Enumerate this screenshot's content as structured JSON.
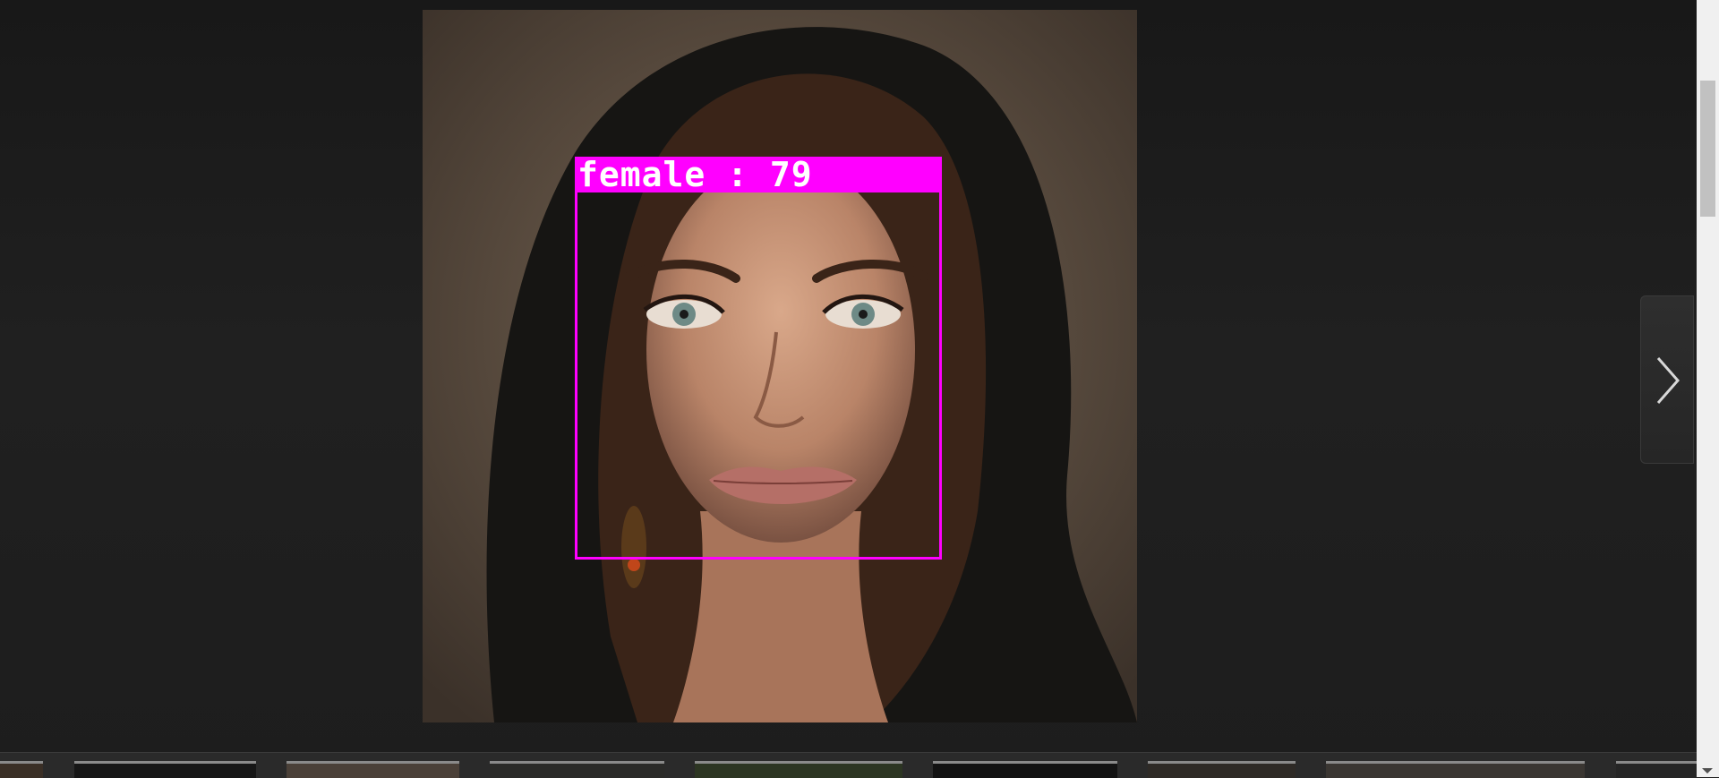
{
  "viewer": {
    "detection": {
      "label": "female : 79",
      "box_color": "#ff00ff",
      "label_text_color": "#ffffff"
    },
    "next_button": {
      "icon": "chevron-right-icon"
    }
  },
  "thumbnails": [
    {
      "name": "thumbnail-1",
      "color": "#3a2f26"
    },
    {
      "name": "thumbnail-2",
      "color": "#161616"
    },
    {
      "name": "thumbnail-3",
      "color": "#4a4038"
    },
    {
      "name": "thumbnail-4",
      "color": "#2a2a28"
    },
    {
      "name": "thumbnail-5",
      "color": "#2c3522"
    },
    {
      "name": "thumbnail-6",
      "color": "#121212"
    },
    {
      "name": "thumbnail-7",
      "color": "#2e2a26"
    },
    {
      "name": "thumbnail-8",
      "color": "#3a3632"
    },
    {
      "name": "thumbnail-9",
      "color": "#252525"
    }
  ]
}
